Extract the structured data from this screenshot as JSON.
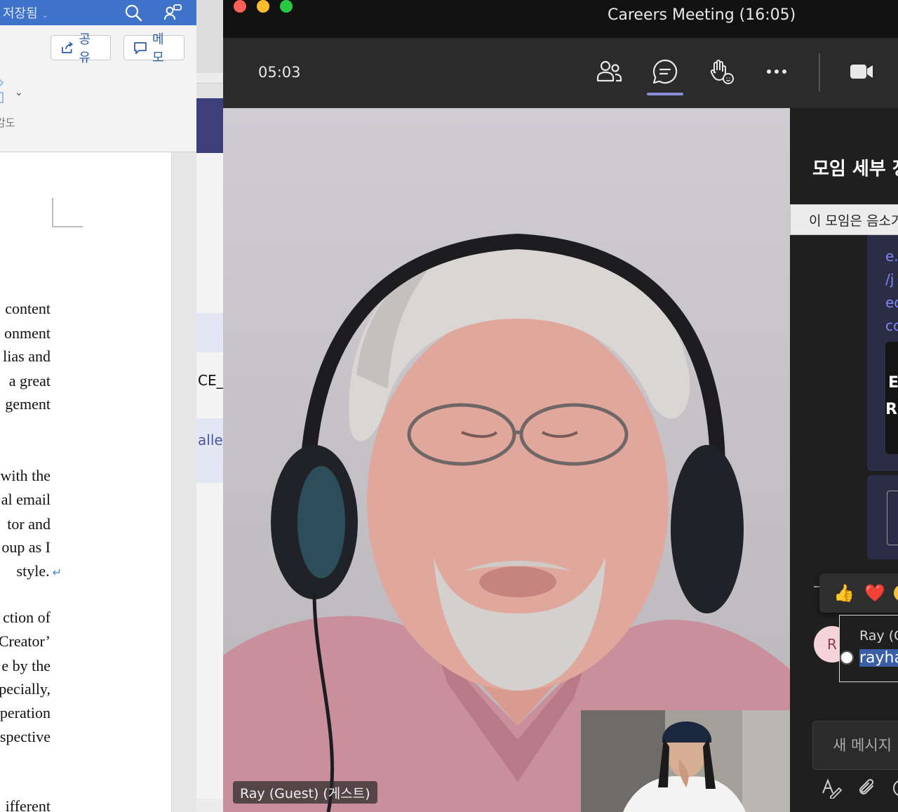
{
  "word": {
    "saved_label": "저장됨",
    "share_label": "공유",
    "comment_label": "메모",
    "sensitivity_label_fragment": "감도",
    "doc_lines": [
      "content",
      "onment",
      "lias and",
      "a  great",
      "gement",
      "with the",
      "al email",
      "tor and",
      "oup as I",
      "style.",
      "ction of",
      "Creator’",
      "e by the",
      "pecially,",
      "peration",
      "spective",
      "ifferent"
    ]
  },
  "background_window": {
    "text_fragment": "CE_I",
    "link_fragment": "aller"
  },
  "teams": {
    "window_title": "Careers Meeting (16:05)",
    "elapsed_time": "05:03",
    "toolbar_buttons": [
      "participants",
      "chat",
      "reactions",
      "more",
      "camera"
    ],
    "active_button": "chat",
    "accent_color": "#8b8cd8",
    "participant_name_tag": "Ray (Guest) (게스트)",
    "panel": {
      "title": "모임 세부 정",
      "banner": "이 모임은 음소거",
      "link_fragments": [
        "e.",
        "/j",
        "ec",
        "cc"
      ],
      "thumbnail_text": [
        "E",
        "RE"
      ],
      "reactions": [
        "👍",
        "❤️"
      ],
      "message": {
        "avatar_initial": "R",
        "sender": "Ray (G",
        "selected_text": "rayha"
      },
      "compose_placeholder": "새 메시지"
    }
  }
}
